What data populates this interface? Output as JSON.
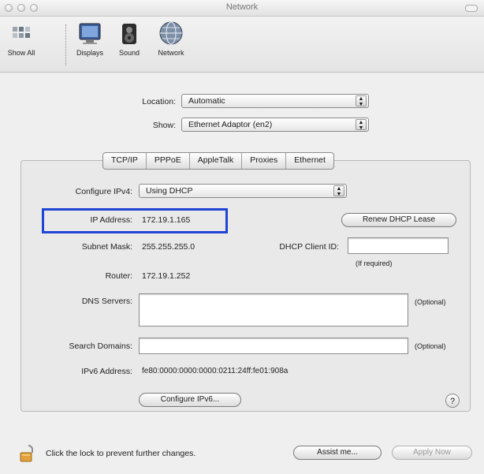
{
  "window": {
    "title": "Network"
  },
  "toolbar": {
    "items": [
      {
        "label": "Show All",
        "icon": "show-all-icon"
      },
      {
        "label": "Displays",
        "icon": "displays-icon"
      },
      {
        "label": "Sound",
        "icon": "sound-icon"
      },
      {
        "label": "Network",
        "icon": "network-icon"
      }
    ]
  },
  "location": {
    "label": "Location:",
    "value": "Automatic"
  },
  "show": {
    "label": "Show:",
    "value": "Ethernet Adaptor (en2)"
  },
  "tabs": [
    "TCP/IP",
    "PPPoE",
    "AppleTalk",
    "Proxies",
    "Ethernet"
  ],
  "form": {
    "configure": {
      "label": "Configure IPv4:",
      "value": "Using DHCP"
    },
    "ip": {
      "label": "IP Address:",
      "value": "172.19.1.165"
    },
    "renew_button": "Renew DHCP Lease",
    "subnet": {
      "label": "Subnet Mask:",
      "value": "255.255.255.0"
    },
    "client_id": {
      "label": "DHCP Client ID:",
      "hint": "(If required)"
    },
    "router": {
      "label": "Router:",
      "value": "172.19.1.252"
    },
    "dns": {
      "label": "DNS Servers:",
      "hint": "(Optional)"
    },
    "search": {
      "label": "Search Domains:",
      "hint": "(Optional)"
    },
    "ipv6": {
      "label": "IPv6 Address:",
      "value": "fe80:0000:0000:0000:0211:24ff:fe01:908a"
    },
    "configure_ipv6_button": "Configure IPv6...",
    "help": "?"
  },
  "footer": {
    "lock_text": "Click the lock to prevent further changes.",
    "assist_button": "Assist me...",
    "apply_button": "Apply Now"
  },
  "colors": {
    "highlight": "#1f44d6"
  }
}
